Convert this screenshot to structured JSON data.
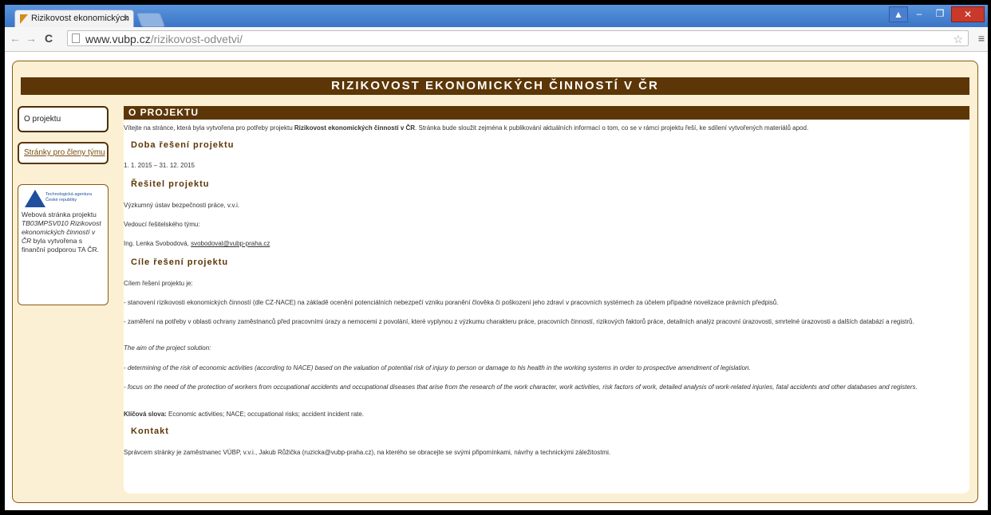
{
  "browser": {
    "tab_title": "Rizikovost ekonomických",
    "tab_close": "×",
    "url_host": "www.vubp.cz",
    "url_path": "/rizikovost-odvetvi/"
  },
  "banner_title": "RIZIKOVOST EKONOMICKÝCH ČINNOSTÍ V ČR",
  "sidebar": {
    "btn_about": "O projektu",
    "btn_team": "Stránky pro členy týmu",
    "logo_text_1": "Technologická agentura",
    "logo_text_2": "České republiky",
    "note_1": "Webová stránka projektu",
    "note_2_it": "TB03MPSV010 Rizikovost ekonomických činností v ČR",
    "note_3": "byla vytvořena s finanční podporou TA ČR."
  },
  "main": {
    "heading": "O PROJEKTU",
    "intro_1": "Vítejte na stránce, která byla vytvořena pro potřeby projektu ",
    "intro_bold": "Rizikovost ekonomických činností v ČR",
    "intro_2": ". Stránka bude sloužit zejména k publikování aktuálních informací o tom, co se v rámci projektu řeší, ke sdílení vytvořených materiálů apod.",
    "h_doba": "Doba řešení projektu",
    "doba": "1. 1. 2015 – 31. 12. 2015",
    "h_resitel": "Řešitel projektu",
    "resitel": "Výzkumný ústav bezpečnosti práce, v.v.i.",
    "vedouci_label": "Vedoucí řešitelského týmu:",
    "vedouci_name": "Ing. Lenka Svobodová, ",
    "vedouci_email": "svobodoval@vubp-praha.cz",
    "h_cile": "Cíle řešení projektu",
    "cil_intro": "Cílem řešení projektu je:",
    "cil_1": "- stanovení rizikovosti ekonomických činností (dle CZ-NACE) na základě ocenění potenciálních nebezpečí vzniku poranění člověka či poškození jeho zdraví v pracovních systémech za účelem případné novelizace právních předpisů.",
    "cil_2": "- zaměření na potřeby v oblasti ochrany zaměstnanců před pracovními úrazy a nemocemi z povolání, které vyplynou z výzkumu charakteru práce, pracovních činností, rizikových faktorů práce, detailních analýz pracovní úrazovosti, smrtelné úrazovosti a dalších databází a registrů.",
    "aim_intro": "The aim of the project solution:",
    "aim_1": "- determining of the risk of economic activities (according to NACE) based on the valuation of potential risk of injury to person or damage to his health in the working systems in order to prospective amendment of legislation.",
    "aim_2": "- focus on the need of the protection of workers from occupational accidents and occupational diseases that arise from the research of the work character, work activities, risk factors of work,  detailed analysis of work-related injuries, fatal accidents and other databases and registers.",
    "keywords_label": "Klíčová slova:",
    "keywords": " Economic activities; NACE; occupational risks; accident incident rate.",
    "h_kontakt": "Kontakt",
    "kontakt": "Správcem stránky je zaměstnanec VÚBP, v.v.i., Jakub Růžička (ruzicka@vubp-praha.cz), na kterého se obracejte se svými připomínkami, návrhy a technickými záležitostmi."
  }
}
